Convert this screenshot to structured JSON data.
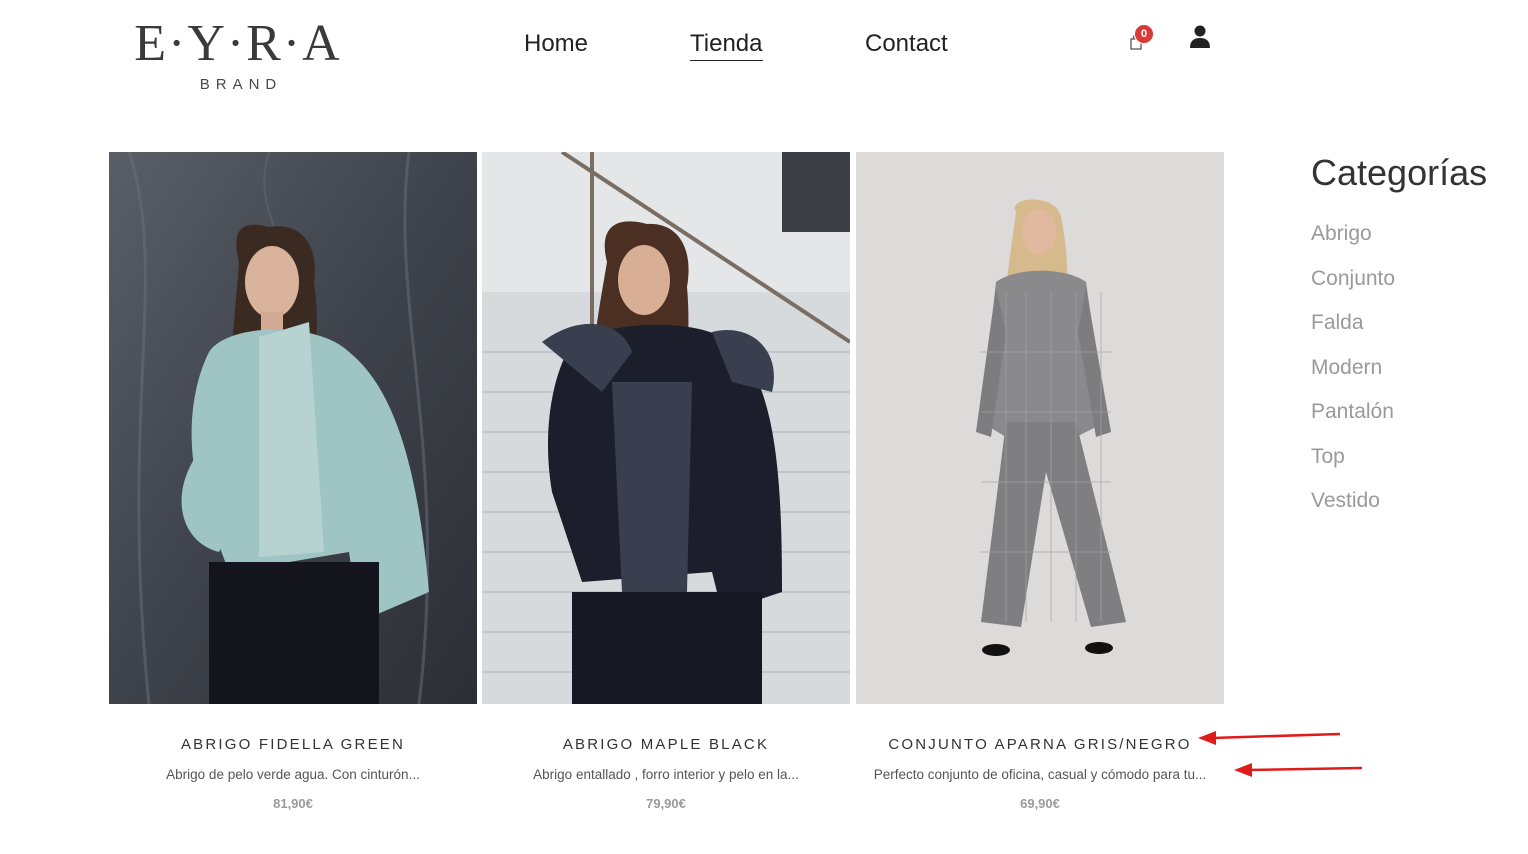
{
  "header": {
    "logo_main": "E·Y·R·A",
    "logo_sub": "BRAND",
    "nav": [
      {
        "label": "Home",
        "active": false
      },
      {
        "label": "Tienda",
        "active": true
      },
      {
        "label": "Contact",
        "active": false
      }
    ],
    "cart_count": "0",
    "cart_icon": "shopping-bag-icon",
    "user_icon": "user-icon"
  },
  "products": [
    {
      "title": "ABRIGO FIDELLA GREEN",
      "description": "Abrigo de pelo verde agua. Con cinturón...",
      "price": "81,90€"
    },
    {
      "title": "ABRIGO MAPLE BLACK",
      "description": "Abrigo entallado , forro interior y pelo en la...",
      "price": "79,90€"
    },
    {
      "title": "CONJUNTO APARNA GRIS/NEGRO",
      "description": "Perfecto conjunto de oficina, casual y cómodo para tu...",
      "price": "69,90€"
    }
  ],
  "sidebar": {
    "title": "Categorías",
    "items": [
      "Abrigo",
      "Conjunto",
      "Falda",
      "Modern",
      "Pantalón",
      "Top",
      "Vestido"
    ]
  },
  "colors": {
    "badge": "#d83a3a",
    "annotation_arrow": "#e01b1b",
    "category_text": "#9a9a9a"
  }
}
